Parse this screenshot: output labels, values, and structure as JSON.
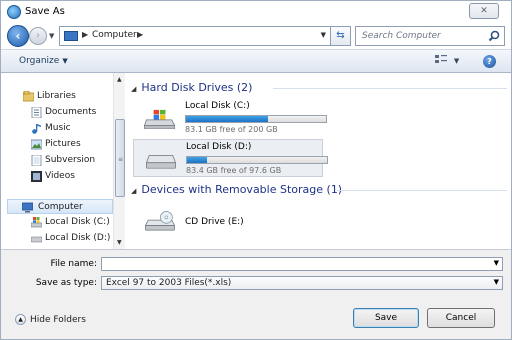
{
  "window": {
    "title": "Save As",
    "close_label": "✕"
  },
  "address": {
    "location": "Computer",
    "search_placeholder": "Search Computer"
  },
  "toolbar": {
    "organize_label": "Organize"
  },
  "nav": {
    "libraries": "Libraries",
    "documents": "Documents",
    "music": "Music",
    "pictures": "Pictures",
    "subversion": "Subversion",
    "videos": "Videos",
    "computer": "Computer",
    "local_c": "Local Disk (C:)",
    "local_d": "Local Disk (D:)"
  },
  "content": {
    "hdd_group": "Hard Disk Drives (2)",
    "removable_group": "Devices with Removable Storage (1)",
    "drives": [
      {
        "name": "Local Disk (C:)",
        "free_text": "83.1 GB free of 200 GB",
        "used_fraction": 0.585
      },
      {
        "name": "Local Disk (D:)",
        "free_text": "83.4 GB free of 97.6 GB",
        "used_fraction": 0.145
      }
    ],
    "cd_drive": "CD Drive (E:)"
  },
  "form": {
    "file_name_label": "File name:",
    "file_name_value": "",
    "save_as_type_label": "Save as type:",
    "save_as_type_value": "Excel 97 to 2003 Files(*.xls)"
  },
  "footer": {
    "hide_folders": "Hide Folders",
    "save": "Save",
    "cancel": "Cancel"
  },
  "colors": {
    "accent": "#1e73c4",
    "group_header": "#1e3287"
  }
}
